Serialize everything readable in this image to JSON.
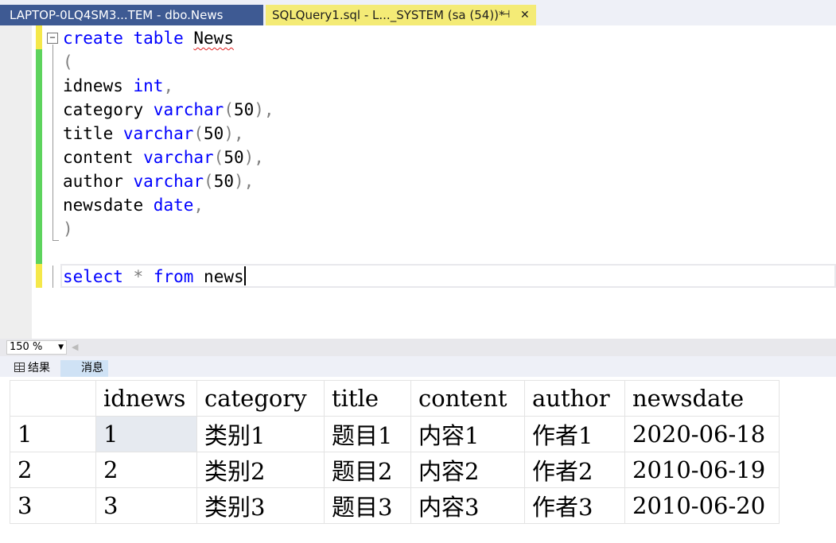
{
  "tabs": [
    {
      "label": "LAPTOP-0LQ4SM3...TEM - dbo.News",
      "active": false
    },
    {
      "label": "SQLQuery1.sql - L..._SYSTEM (sa (54))*",
      "active": true,
      "pin": "⊣",
      "close": "✕"
    }
  ],
  "editor": {
    "lines": [
      {
        "tokens": [
          {
            "t": "create",
            "c": "kw"
          },
          {
            "t": " "
          },
          {
            "t": "table",
            "c": "kw"
          },
          {
            "t": " "
          },
          {
            "t": "News",
            "c": "squiggle"
          }
        ]
      },
      {
        "tokens": [
          {
            "t": "(",
            "c": "gr"
          }
        ]
      },
      {
        "tokens": [
          {
            "t": "idnews "
          },
          {
            "t": "int",
            "c": "kw"
          },
          {
            "t": ",",
            "c": "gr"
          }
        ]
      },
      {
        "tokens": [
          {
            "t": "category "
          },
          {
            "t": "varchar",
            "c": "kw"
          },
          {
            "t": "(",
            "c": "gr"
          },
          {
            "t": "50"
          },
          {
            "t": "),",
            "c": "gr"
          }
        ]
      },
      {
        "tokens": [
          {
            "t": "title "
          },
          {
            "t": "varchar",
            "c": "kw"
          },
          {
            "t": "(",
            "c": "gr"
          },
          {
            "t": "50"
          },
          {
            "t": "),",
            "c": "gr"
          }
        ]
      },
      {
        "tokens": [
          {
            "t": "content "
          },
          {
            "t": "varchar",
            "c": "kw"
          },
          {
            "t": "(",
            "c": "gr"
          },
          {
            "t": "50"
          },
          {
            "t": "),",
            "c": "gr"
          }
        ]
      },
      {
        "tokens": [
          {
            "t": "author "
          },
          {
            "t": "varchar",
            "c": "kw"
          },
          {
            "t": "(",
            "c": "gr"
          },
          {
            "t": "50"
          },
          {
            "t": "),",
            "c": "gr"
          }
        ]
      },
      {
        "tokens": [
          {
            "t": "newsdate "
          },
          {
            "t": "date",
            "c": "kw"
          },
          {
            "t": ",",
            "c": "gr"
          }
        ]
      },
      {
        "tokens": [
          {
            "t": ")",
            "c": "gr"
          }
        ]
      },
      {
        "tokens": []
      },
      {
        "tokens": [
          {
            "t": "select",
            "c": "kw"
          },
          {
            "t": " "
          },
          {
            "t": "*",
            "c": "gr"
          },
          {
            "t": " "
          },
          {
            "t": "from",
            "c": "kw"
          },
          {
            "t": " news"
          }
        ],
        "caret": true
      }
    ],
    "fold_symbol": "−"
  },
  "zoom": {
    "value": "150 %",
    "arrow": "▼",
    "scroll_left": "◀"
  },
  "result_tabs": {
    "results": "结果",
    "messages": "消息"
  },
  "results": {
    "columns": [
      "",
      "idnews",
      "category",
      "title",
      "content",
      "author",
      "newsdate"
    ],
    "rows": [
      [
        "1",
        "1",
        "类别1",
        "题目1",
        "内容1",
        "作者1",
        "2020-06-18"
      ],
      [
        "2",
        "2",
        "类别2",
        "题目2",
        "内容2",
        "作者2",
        "2010-06-19"
      ],
      [
        "3",
        "3",
        "类别3",
        "题目3",
        "内容3",
        "作者3",
        "2010-06-20"
      ]
    ]
  },
  "colors": {
    "active_tab": "#f4eb76",
    "inactive_tab": "#3e5a93",
    "keyword": "#0000ff",
    "punctuation": "#808080",
    "saved_change_bar": "#5dd35d",
    "unsaved_change_bar": "#f5e84a"
  }
}
